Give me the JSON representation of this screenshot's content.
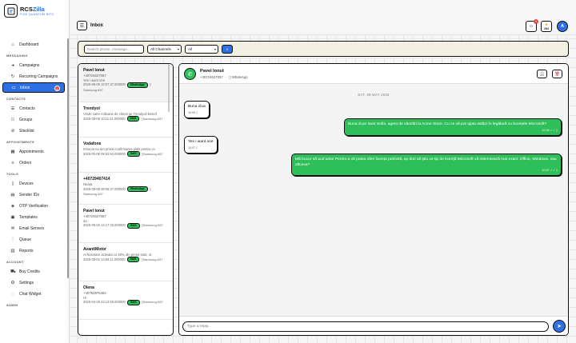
{
  "brand": {
    "name_main": "RCS",
    "name_accent": "Zilla",
    "tagline": "FIVE QUANTUM BITS"
  },
  "sidebar": {
    "sections": [
      {
        "label": "",
        "items": [
          {
            "label": "Dashboard",
            "icon": "home-icon"
          }
        ]
      },
      {
        "label": "MESSAGING",
        "items": [
          {
            "label": "Campaigns",
            "icon": "megaphone-icon"
          },
          {
            "label": "Recurring Campaigns",
            "icon": "refresh-icon"
          },
          {
            "label": "Inbox",
            "icon": "inbox-icon",
            "active": true,
            "badge": "1"
          }
        ]
      },
      {
        "label": "CONTACTS",
        "items": [
          {
            "label": "Contacts",
            "icon": "contacts-icon"
          },
          {
            "label": "Groups",
            "icon": "groups-icon"
          },
          {
            "label": "Stacklist",
            "icon": "block-icon"
          }
        ]
      },
      {
        "label": "APPOINTMENTS",
        "items": [
          {
            "label": "Appointments",
            "icon": "calendar-icon"
          },
          {
            "label": "Orders",
            "icon": "orders-icon"
          }
        ]
      },
      {
        "label": "TOOLS",
        "items": [
          {
            "label": "Devices",
            "icon": "phone-icon"
          },
          {
            "label": "Sender IDs",
            "icon": "id-icon"
          },
          {
            "label": "OTP Verification",
            "icon": "shield-icon"
          },
          {
            "label": "Templates",
            "icon": "template-icon"
          },
          {
            "label": "Email Servers",
            "icon": "mail-icon"
          },
          {
            "label": "Queue",
            "icon": "queue-icon"
          },
          {
            "label": "Reports",
            "icon": "report-icon"
          }
        ]
      },
      {
        "label": "ACCOUNT",
        "items": [
          {
            "label": "Buy Credits",
            "icon": "cart-icon"
          },
          {
            "label": "Settings",
            "icon": "gear-icon"
          },
          {
            "label": "Chat Widget",
            "icon": "chat-icon"
          }
        ]
      },
      {
        "label": "ADMIN",
        "items": []
      }
    ]
  },
  "header": {
    "title": "Inbox",
    "notif_badge": "4",
    "credits": "284",
    "avatar_initial": "A"
  },
  "filters": {
    "search_placeholder": "Search phone, message...",
    "channel_select": "All Channels",
    "status_select": "All"
  },
  "conversations": [
    {
      "name": "Pavel Ionut",
      "phone": "+40724627057",
      "preview": "Yes i want one",
      "time": "2026-05-09 10:07:37.000000",
      "channel": "WhatsApp",
      "device": "Samsung A57",
      "selected": true
    },
    {
      "name": "Trendyol",
      "phone": "",
      "preview": "Vinde catre milioane de clienti pe Trendyol! Benef",
      "time": "2026-05-08 10:11:24.000000",
      "channel": "SMS",
      "device": "Samsung A57"
    },
    {
      "name": "Vodafone",
      "phone": "",
      "preview": "Intrucat nu am primit confirmarea platii pentru co",
      "time": "2026-05-08 08:52:52.000000",
      "channel": "SMS",
      "device": "Samsung A57"
    },
    {
      "name": "+40729407414",
      "phone": "",
      "preview": "Neata",
      "time": "2026-05-08 08:05:37.000000",
      "channel": "WhatsApp",
      "device": "Samsung A57"
    },
    {
      "name": "Pavel Ionut",
      "phone": "+40724627057",
      "preview": "da",
      "time": "2026-05-03 14:17:32.000000",
      "channel": "SMS",
      "device": "Samsung A57"
    },
    {
      "name": "AvantiMotor",
      "phone": "",
      "preview": "Ai finantare activata cu 50% din pretul total, ra",
      "time": "2026-05-02 13:58:11.000000",
      "channel": "SMS",
      "device": "Samsung A57"
    },
    {
      "name": "Olena",
      "phone": "+40752876464",
      "preview": "Hi",
      "time": "2026-04-29 22:13:50.000000",
      "channel": "SMS",
      "device": "Samsung A57"
    }
  ],
  "chat": {
    "contact_name": "Pavel Ionut",
    "contact_phone": "+40724627057",
    "channel": "WhatsApp",
    "date_separator": "SAT, 09 MAY 2026",
    "messages": [
      {
        "dir": "in",
        "text": "Buna ziua",
        "time": "10:06"
      },
      {
        "dir": "out",
        "text": "Buna ziua! Sunt Sofia, agent de vânzări la Acme Store. Cu ce vă pot ajuta astăzi în legătură cu licențele Microsoft?",
        "time": "10:06"
      },
      {
        "dir": "in",
        "text": "Yes i want one",
        "time": "10:07"
      },
      {
        "dir": "out",
        "text": "Mă bucur să aud asta! Pentru a vă putea oferi licența potrivită, aș dori să știu ce tip de licență Microsoft vă interesează mai exact: Office, Windows, sau altceva?",
        "time": "10:07"
      }
    ],
    "reply_placeholder": "Type a reply..."
  },
  "colors": {
    "accent": "#2f6fe4",
    "whatsapp": "#2fbf5a",
    "danger": "#e54848",
    "panel": "#f2f0e3"
  }
}
